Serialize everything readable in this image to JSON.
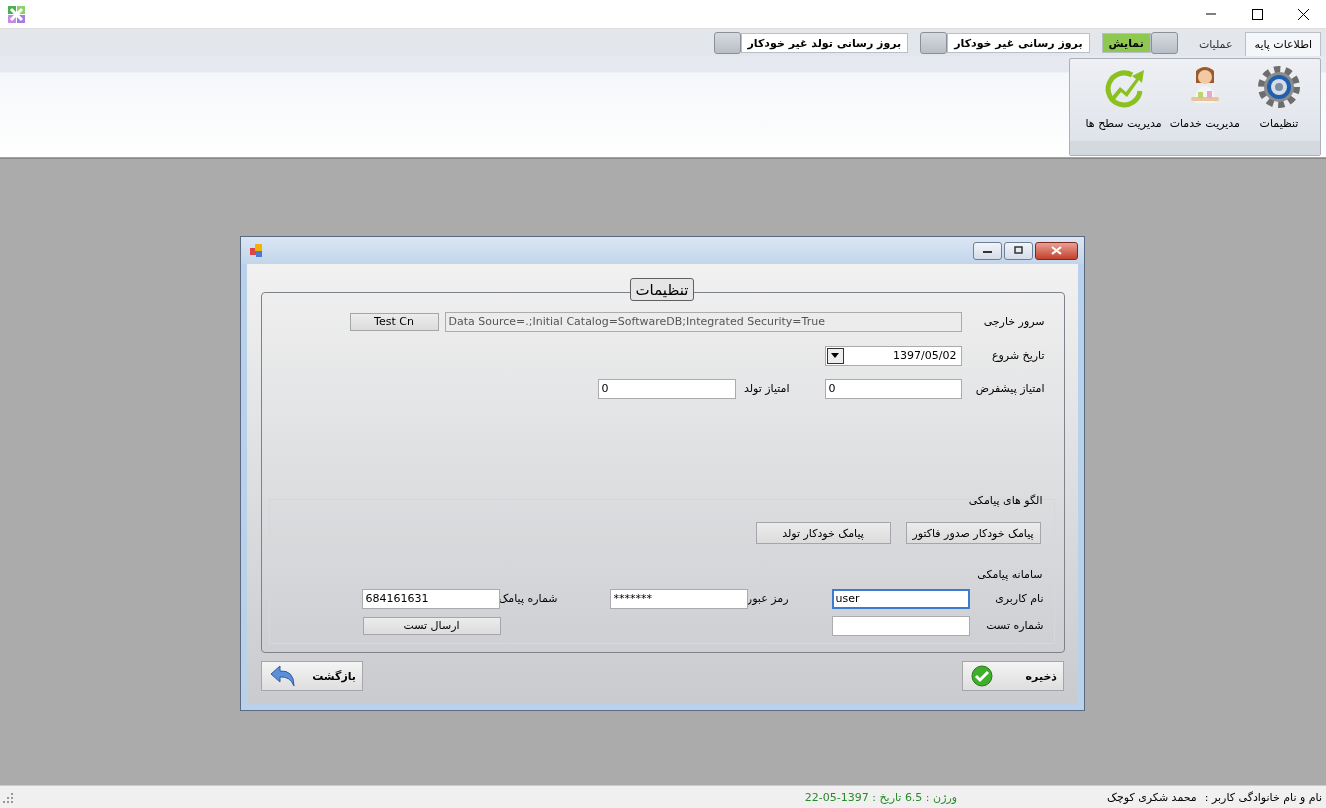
{
  "ribbon": {
    "tabs": [
      {
        "label": "اطلاعات پایه",
        "selected": true
      },
      {
        "label": "عملیات",
        "selected": false
      }
    ],
    "toggles": [
      {
        "label": "نمایش",
        "on": true
      },
      {
        "label": "بروز رسانی غیر خودکار",
        "on": false
      },
      {
        "label": "بروز رسانی تولد غیر خودکار",
        "on": false
      }
    ],
    "buttons": [
      {
        "label": "تنظیمات",
        "kind": "gear"
      },
      {
        "label": "مدیریت خدمات",
        "kind": "person"
      },
      {
        "label": "مدیریت سطح ها",
        "kind": "growth"
      }
    ]
  },
  "dialog": {
    "group_title": "تنظیمات",
    "server": {
      "label": "سرور خارجی",
      "value": "Data Source=.;Initial Catalog=SoftwareDB;Integrated Security=True",
      "button": "Test Cn"
    },
    "start_date": {
      "label": "تاریخ شروع",
      "value": "1397/05/02"
    },
    "default_score": {
      "label": "امتیاز پیشفرض",
      "value": "0"
    },
    "birthday_score": {
      "label": "امتیاز تولد",
      "value": "0"
    },
    "sms_templates": {
      "title": "الگو های پیامکی",
      "buttons": [
        "پیامک خودکار صدور فاکتور",
        "پیامک خودکار تولد"
      ]
    },
    "sms_system": {
      "title": "سامانه پیامکی",
      "username": {
        "label": "نام کاربری",
        "value": "user",
        "focused": true
      },
      "password": {
        "label": "رمز عبور",
        "value": "*******",
        "focused": false
      },
      "sms_number": {
        "label": "شماره پیامک",
        "value": "684161631",
        "focused": false
      },
      "test_number": {
        "label": "شماره تست",
        "focused": false
      },
      "send_test": "ارسال تست"
    },
    "save": "ذخیره",
    "back": "بازگشت"
  },
  "status_bar": {
    "user_label": "نام و نام خانوادگی کاربر :",
    "user_name": "محمد شکری کوچک",
    "version": "ورژن : 6.5 تاریخ : 1397-05-22"
  }
}
